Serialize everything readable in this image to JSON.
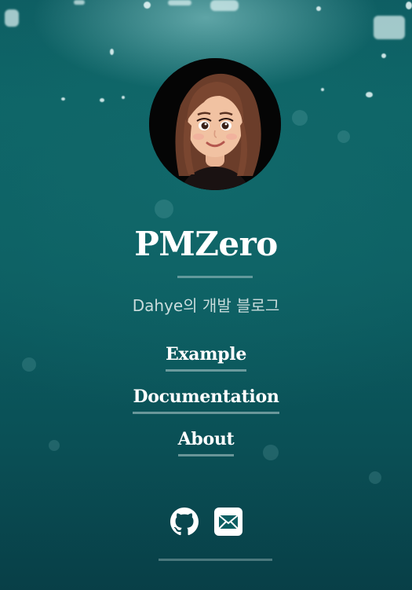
{
  "site": {
    "title": "PMZero",
    "tagline": "Dahye의 개발 블로그"
  },
  "nav": {
    "items": [
      {
        "label": "Example"
      },
      {
        "label": "Documentation"
      },
      {
        "label": "About"
      }
    ]
  },
  "social": {
    "github_icon": "github-icon",
    "email_icon": "email-icon"
  },
  "colors": {
    "background_teal": "#0c5e62",
    "text": "#ffffff",
    "tagline_text": "#c9dcdc"
  }
}
